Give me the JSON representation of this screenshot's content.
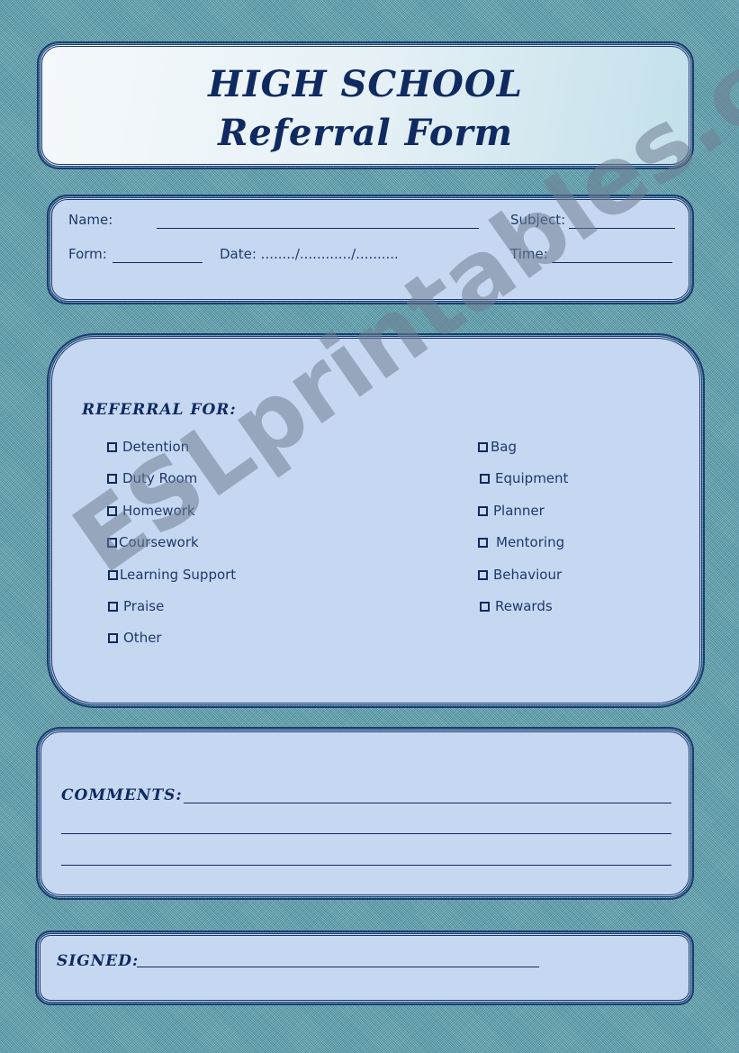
{
  "header": {
    "title_line1": "HIGH SCHOOL",
    "title_line2": "Referral Form"
  },
  "info": {
    "name_label": "Name:",
    "subject_label": "Subject:",
    "form_label": "Form:",
    "date_label": "Date: ......../............/..........",
    "time_label": "Time:"
  },
  "referral": {
    "title": "REFERRAL FOR:",
    "left_options": [
      "Detention",
      "Duty Room",
      "Homework",
      "Coursework",
      "Learning Support",
      "Praise",
      "Other"
    ],
    "right_options": [
      "Bag",
      "Equipment",
      "Planner",
      "Mentoring",
      "Behaviour",
      "Rewards"
    ]
  },
  "comments": {
    "title": "COMMENTS:"
  },
  "signed": {
    "title": "SIGNED:"
  },
  "watermark": "ESLprintables.com",
  "colors": {
    "ink": "#0f2a60",
    "panel": "#c6d8f1",
    "background": "#6fa3ad"
  }
}
